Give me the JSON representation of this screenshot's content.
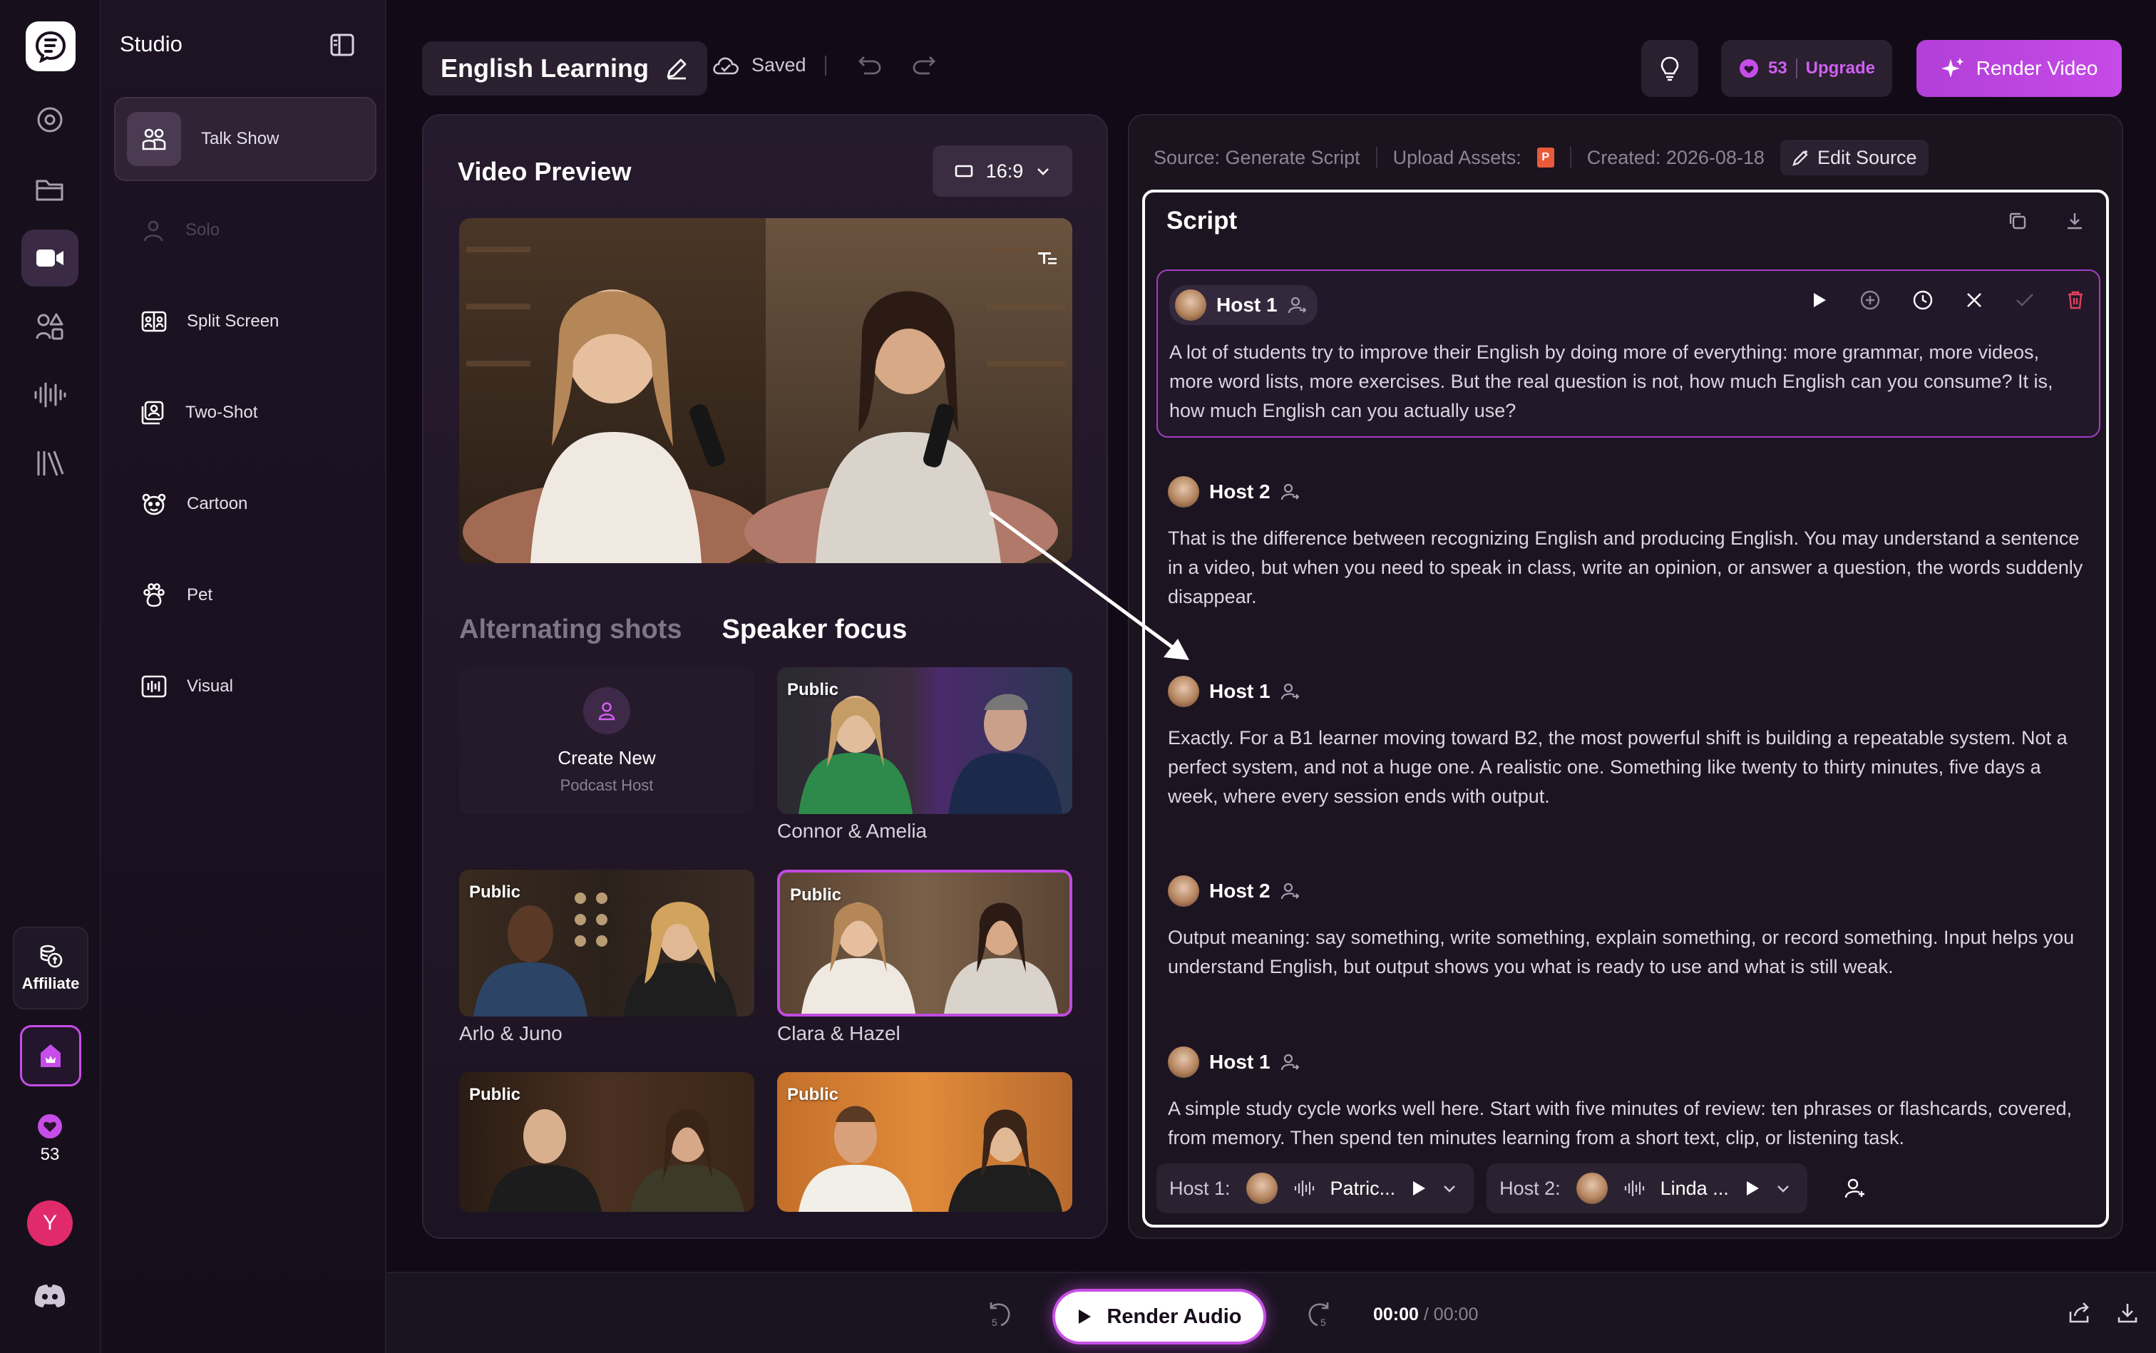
{
  "sidebar": {
    "title": "Studio",
    "items": [
      {
        "label": "Talk Show",
        "icon": "group-icon"
      },
      {
        "label": "Solo",
        "icon": "person-icon"
      },
      {
        "label": "Split Screen",
        "icon": "split-screen-icon"
      },
      {
        "label": "Two-Shot",
        "icon": "two-shot-icon"
      },
      {
        "label": "Cartoon",
        "icon": "cartoon-icon"
      },
      {
        "label": "Pet",
        "icon": "paw-icon"
      },
      {
        "label": "Visual",
        "icon": "visual-icon"
      }
    ]
  },
  "rail": {
    "affiliate_label": "Affiliate",
    "credits": "53",
    "avatar_letter": "Y"
  },
  "topbar": {
    "project_title": "English Learning",
    "saved_label": "Saved",
    "credits": "53",
    "upgrade_label": "Upgrade",
    "render_video_label": "Render Video"
  },
  "preview": {
    "title": "Video Preview",
    "aspect_ratio": "16:9",
    "tabs": [
      "Alternating shots",
      "Speaker focus"
    ],
    "create_card": {
      "title": "Create New",
      "subtitle": "Podcast Host"
    },
    "badge": "Public",
    "cards": [
      {
        "label": "Connor & Amelia"
      },
      {
        "label": "Arlo & Juno"
      },
      {
        "label": "Clara & Hazel"
      },
      {
        "label": ""
      },
      {
        "label": ""
      }
    ]
  },
  "script": {
    "source": "Source: Generate Script",
    "upload_assets": "Upload Assets:",
    "created": "Created: 2026-08-18",
    "edit_source": "Edit Source",
    "title": "Script",
    "segments": [
      {
        "host": "Host 1",
        "text": "A lot of students try to improve their English by doing more of everything: more grammar, more videos, more word lists, more exercises. But the real question is not, how much English can you consume? It is, how much English can you actually use?"
      },
      {
        "host": "Host 2",
        "text": "That is the difference between recognizing English and producing English. You may understand a sentence in a video, but when you need to speak in class, write an opinion, or answer a question, the words suddenly disappear."
      },
      {
        "host": "Host 1",
        "text": "Exactly. For a B1 learner moving toward B2, the most powerful shift is building a repeatable system. Not a perfect system, and not a huge one. A realistic one. Something like twenty to thirty minutes, five days a week, where every session ends with output."
      },
      {
        "host": "Host 2",
        "text": "Output meaning: say something, write something, explain something, or record something. Input helps you understand English, but output shows you what is ready to use and what is still weak."
      },
      {
        "host": "Host 1",
        "text": "A simple study cycle works well here. Start with five minutes of review: ten phrases or flashcards, covered, from memory. Then spend ten minutes learning from a short text, clip, or listening task."
      }
    ],
    "voices": [
      {
        "label": "Host 1:",
        "voice": "Patric..."
      },
      {
        "label": "Host 2:",
        "voice": "Linda ..."
      }
    ]
  },
  "bottombar": {
    "render_audio_label": "Render Audio",
    "time_current": "00:00",
    "time_total": "/ 00:00"
  },
  "colors": {
    "accent": "#c14be0",
    "background": "#120b17",
    "avatar": "#e12a6a"
  }
}
